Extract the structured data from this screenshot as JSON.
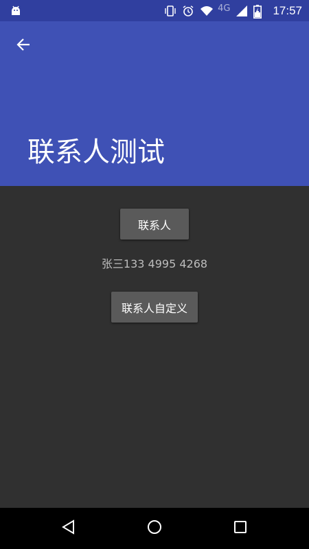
{
  "status_bar": {
    "time": "17:57",
    "network": "4G",
    "left_icon": "android-debug-icon",
    "icons": [
      "vibrate-icon",
      "alarm-icon",
      "wifi-icon",
      "cell-signal-icon",
      "battery-charging-icon"
    ],
    "color": "#303F9F"
  },
  "app_bar": {
    "title": "联系人测试",
    "back_icon": "back-arrow-icon",
    "color": "#3F51B5"
  },
  "main": {
    "contacts_button_label": "联系人",
    "contact_result": "张三133 4995 4268",
    "custom_button_label": "联系人自定义",
    "background": "#303030"
  },
  "nav_bar": {
    "back_icon": "nav-back-icon",
    "home_icon": "nav-home-icon",
    "recent_icon": "nav-recent-icon"
  }
}
